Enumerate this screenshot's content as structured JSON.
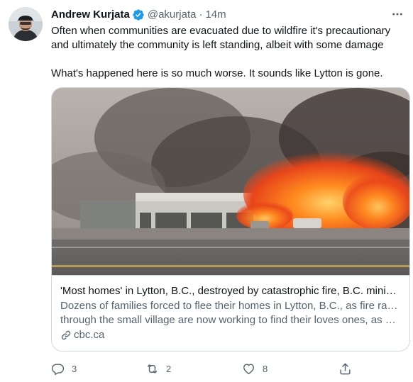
{
  "author": {
    "name": "Andrew Kurjata",
    "handle": "@akurjata",
    "separator": "·",
    "time": "14m",
    "verified": true
  },
  "tweet": {
    "paragraphs": [
      "Often when communities are evacuated due to wildfire it's precautionary and ultimately the community is left standing, albeit with some damage",
      "What's happened here is so much worse. It sounds like Lytton is gone."
    ]
  },
  "card": {
    "title": "'Most homes' in Lytton, B.C., destroyed by catastrophic fire, B.C. minist…",
    "description_lines": [
      "Dozens of families forced to flee their homes in Lytton, B.C., as fire raced",
      "through the small village are now working to find their loves ones, as …"
    ],
    "domain": "cbc.ca",
    "image_icon": "wildfire-photo"
  },
  "actions": {
    "reply": {
      "icon": "reply-icon",
      "count": "3"
    },
    "retweet": {
      "icon": "retweet-icon",
      "count": "2"
    },
    "like": {
      "icon": "heart-icon",
      "count": "8"
    },
    "share": {
      "icon": "share-icon",
      "count": ""
    }
  },
  "colors": {
    "text": "#0f1419",
    "secondary": "#536471",
    "verified": "#1d9bf0",
    "border": "#cfd9de"
  }
}
